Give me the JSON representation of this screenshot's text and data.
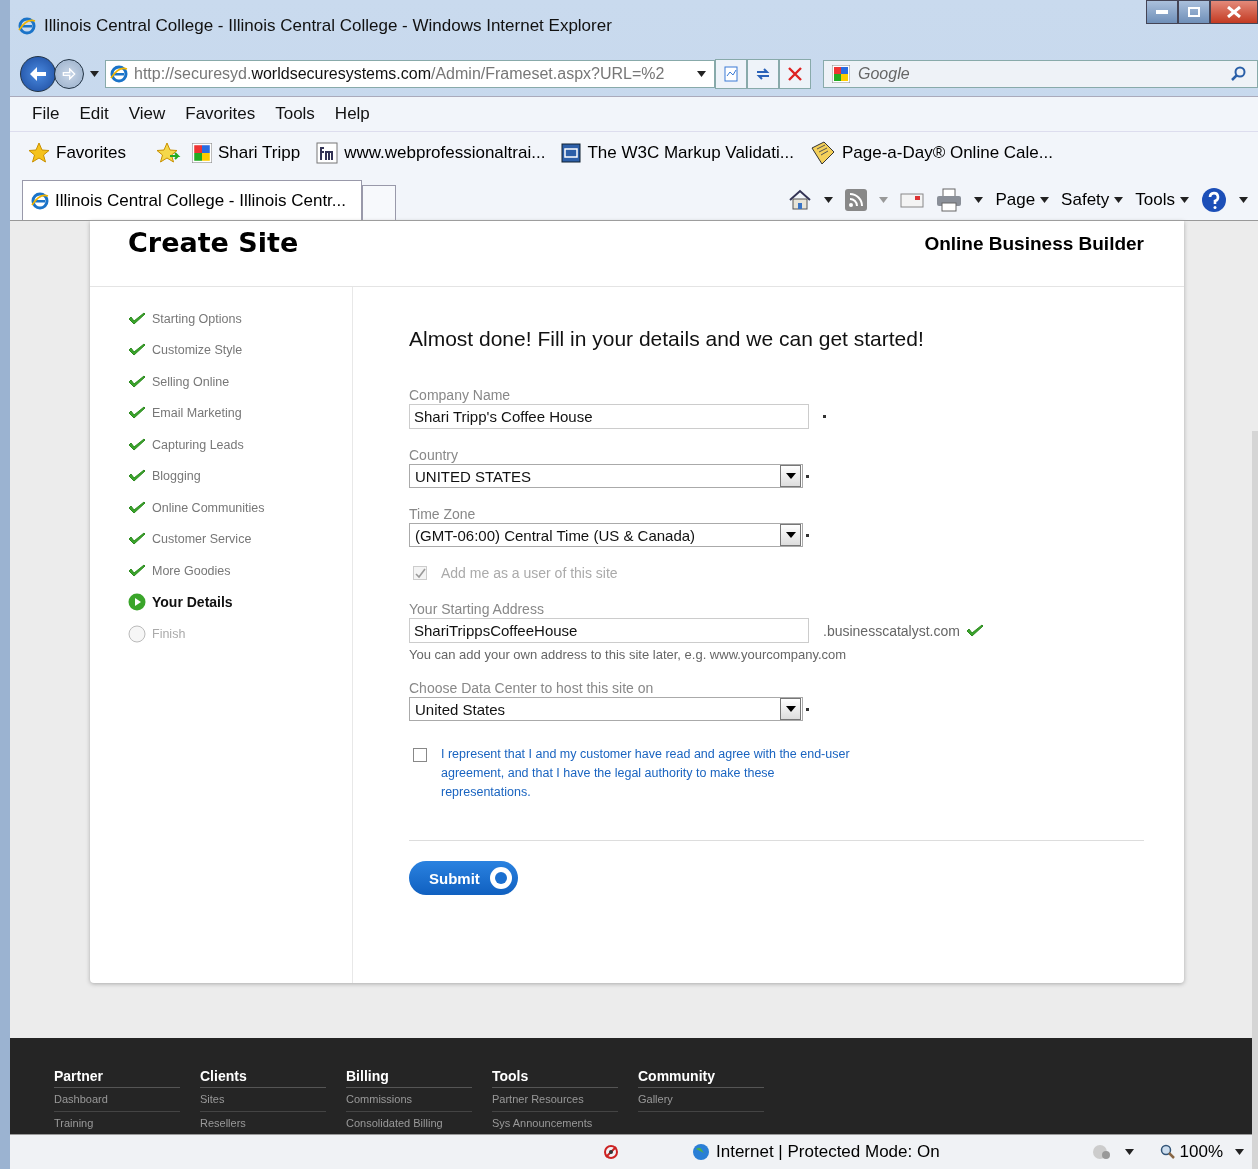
{
  "window": {
    "title": "Illinois Central College - Illinois Central College - Windows Internet Explorer"
  },
  "address_bar": {
    "url_dim": "http://securesyd.",
    "url_host": "worldsecuresystems.com",
    "url_path": "/Admin/Frameset.aspx?URL=%2"
  },
  "search": {
    "placeholder": "Google"
  },
  "menu": [
    "File",
    "Edit",
    "View",
    "Favorites",
    "Tools",
    "Help"
  ],
  "favorites_label": "Favorites",
  "favorites": [
    {
      "label": "Shari Tripp",
      "kind": "google"
    },
    {
      "label": "www.webprofessionaltrai...",
      "kind": "fm"
    },
    {
      "label": "The W3C Markup Validati...",
      "kind": "w3"
    },
    {
      "label": "Page-a-Day® Online Cale...",
      "kind": "calendar"
    }
  ],
  "tab": {
    "title": "Illinois Central College - Illinois Centr..."
  },
  "command_bar": [
    "Page",
    "Safety",
    "Tools"
  ],
  "page": {
    "title": "Create Site",
    "brand": "Online Business Builder"
  },
  "steps": [
    {
      "label": "Starting Options",
      "completed": true,
      "selected": false
    },
    {
      "label": "Customize Style",
      "completed": true,
      "selected": false
    },
    {
      "label": "Selling Online",
      "completed": true,
      "selected": false
    },
    {
      "label": "Email Marketing",
      "completed": true,
      "selected": false
    },
    {
      "label": "Capturing Leads",
      "completed": true,
      "selected": false
    },
    {
      "label": "Blogging",
      "completed": true,
      "selected": false
    },
    {
      "label": "Online Communities",
      "completed": true,
      "selected": false
    },
    {
      "label": "Customer Service",
      "completed": true,
      "selected": false
    },
    {
      "label": "More Goodies",
      "completed": true,
      "selected": false
    },
    {
      "label": "Your Details",
      "completed": false,
      "selected": true
    },
    {
      "label": "Finish",
      "completed": false,
      "selected": false
    }
  ],
  "form": {
    "heading": "Almost done! Fill in your details and we can get started!",
    "company": {
      "label": "Company Name",
      "value": "Shari Tripp's Coffee House"
    },
    "country": {
      "label": "Country",
      "value": "UNITED STATES"
    },
    "time_zone": {
      "label": "Time Zone",
      "value": "(GMT-06:00) Central Time (US & Canada)"
    },
    "add_user": {
      "label": "Add me as a user of this site",
      "checked": true,
      "disabled": true
    },
    "address": {
      "label": "Your Starting Address",
      "value": "ShariTrippsCoffeeHouse",
      "suffix": ".businesscatalyst.com",
      "valid": true,
      "hint": "You can add your own address to this site later, e.g. www.yourcompany.com"
    },
    "data_center": {
      "label": "Choose Data Center to host this site on",
      "value": "United States"
    },
    "agreement": {
      "text": "I represent that I and my customer have read and agree with the end-user agreement, and that I have the legal authority to make these representations.",
      "checked": false
    },
    "submit": "Submit"
  },
  "footer": [
    {
      "title": "Partner",
      "links": [
        "Dashboard",
        "Training"
      ]
    },
    {
      "title": "Clients",
      "links": [
        "Sites",
        "Resellers"
      ]
    },
    {
      "title": "Billing",
      "links": [
        "Commissions",
        "Consolidated Billing"
      ]
    },
    {
      "title": "Tools",
      "links": [
        "Partner Resources",
        "Sys Announcements"
      ]
    },
    {
      "title": "Community",
      "links": [
        "Gallery"
      ]
    }
  ],
  "status_bar": {
    "zone": "Internet | Protected Mode: On",
    "zoom": "100%"
  }
}
